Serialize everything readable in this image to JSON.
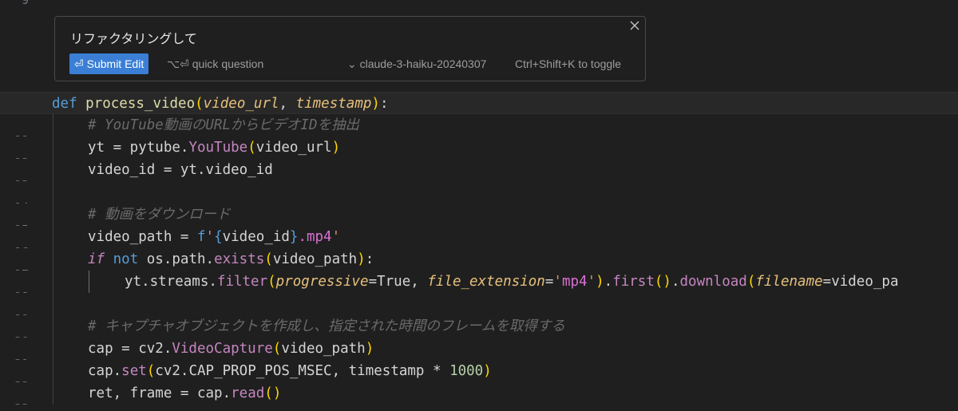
{
  "editor": {
    "partial_line_number": "9",
    "lines": [
      {
        "num": "10"
      },
      {
        "num": "11",
        "comment": "# YouTube動画のURLからビデオIDを抽出"
      },
      {
        "num": "12"
      },
      {
        "num": "13"
      },
      {
        "num": "14"
      },
      {
        "num": "15",
        "comment": "# 動画をダウンロード"
      },
      {
        "num": "16"
      },
      {
        "num": "17"
      },
      {
        "num": "18"
      },
      {
        "num": "19"
      },
      {
        "num": "20",
        "comment": "# キャプチャオブジェクトを作成し、指定された時間のフレームを取得する"
      },
      {
        "num": "21"
      },
      {
        "num": "22"
      },
      {
        "num": "23"
      }
    ]
  },
  "prompt": {
    "text": "リファクタリングして",
    "submit_label": "⏎ Submit Edit",
    "quick_question_label": "⌥⏎ quick question",
    "model_label": "⌄ claude-3-haiku-20240307",
    "toggle_hint": "Ctrl+Shift+K to toggle",
    "close_icon": "close-icon"
  },
  "colors": {
    "background": "#1f1f1f",
    "submit_button": "#3b7ed6",
    "keyword": "#569cd6",
    "function": "#dcdcaa",
    "string": "#ce9178",
    "number": "#b5cea8"
  }
}
